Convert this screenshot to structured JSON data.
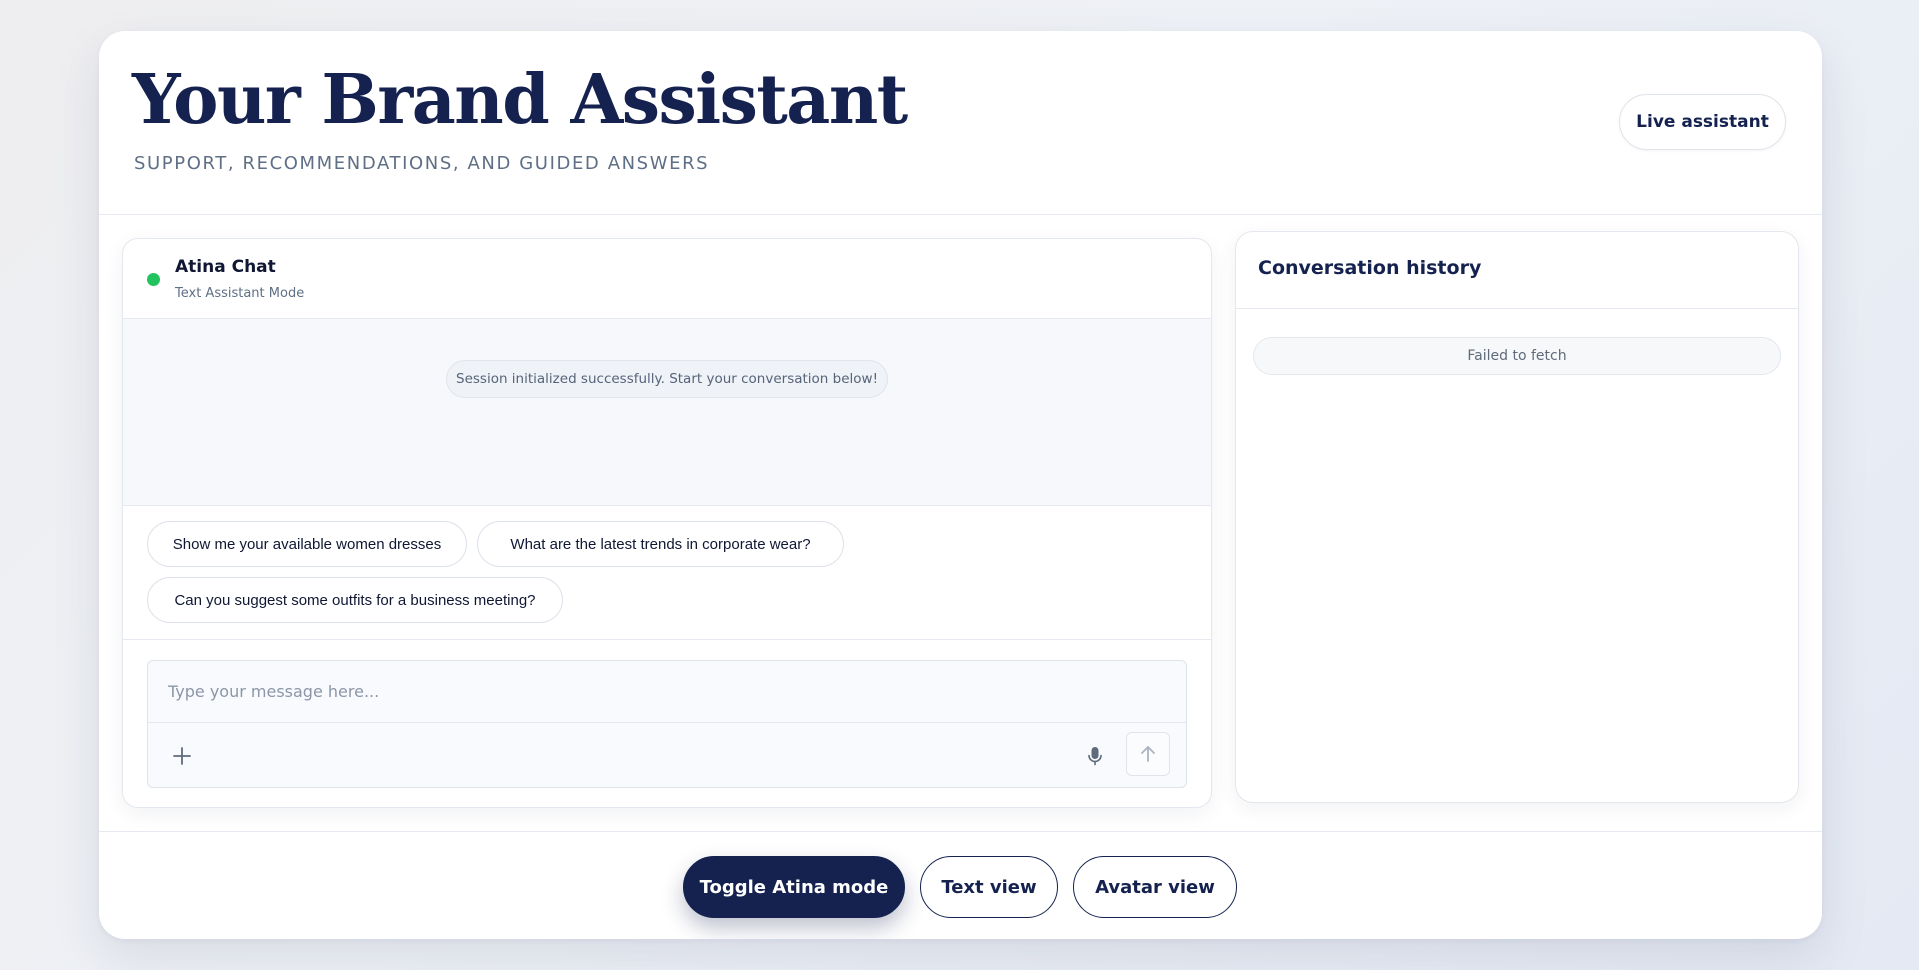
{
  "header": {
    "title": "Your Brand Assistant",
    "subtitle": "SUPPORT, RECOMMENDATIONS, AND GUIDED ANSWERS",
    "live_button": "Live assistant"
  },
  "chat": {
    "title": "Atina Chat",
    "mode": "Text Assistant Mode",
    "status": "online",
    "status_color": "#22c35e",
    "system_message": "Session initialized successfully. Start your conversation below!",
    "suggestions": [
      "Show me your available women dresses",
      "What are the latest trends in corporate wear?",
      "Can you suggest some outfits for a business meeting?"
    ],
    "input": {
      "value": "",
      "placeholder": "Type your message here..."
    },
    "icons": {
      "attach": "plus-icon",
      "voice": "microphone-icon",
      "send": "arrow-up-icon"
    }
  },
  "history": {
    "title": "Conversation history",
    "error": "Failed to fetch"
  },
  "footer": {
    "toggle_button": "Toggle Atina mode",
    "text_view_button": "Text view",
    "avatar_view_button": "Avatar view"
  },
  "colors": {
    "brand_navy": "#15224f",
    "muted_text": "#5f6f86",
    "online_green": "#22c35e"
  }
}
